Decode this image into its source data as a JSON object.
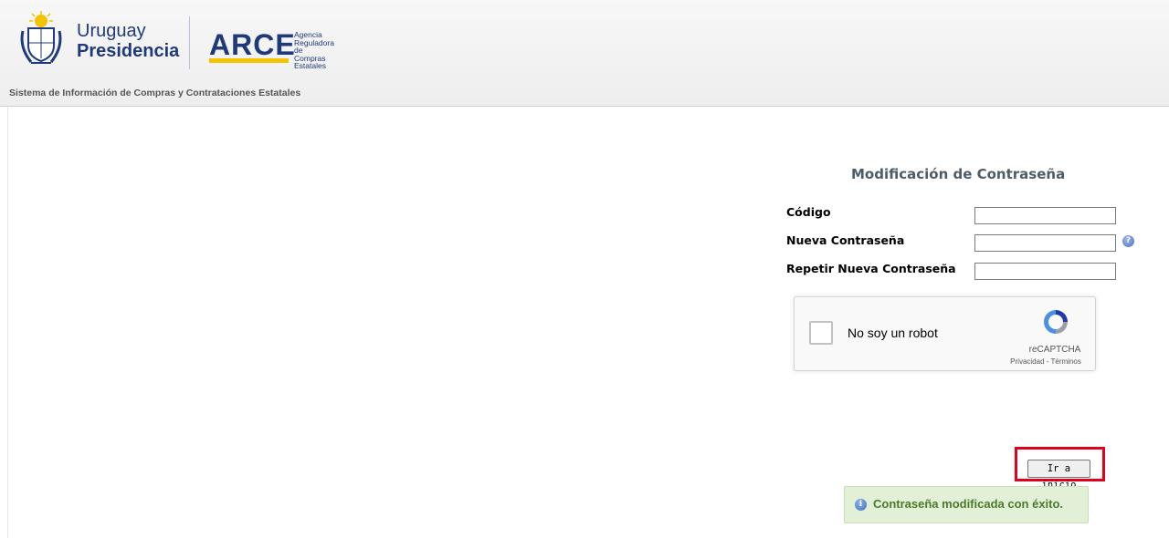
{
  "header": {
    "gob_line1": "Uruguay",
    "gob_line2": "Presidencia",
    "arce_name": "ARCE",
    "arce_sub1": "Agencia",
    "arce_sub2": "Reguladora de",
    "arce_sub3": "Compras Estatales",
    "system_title": "Sistema de Información de Compras y Contrataciones Estatales"
  },
  "form": {
    "title": "Modificación de Contraseña",
    "codigo_label": "Código",
    "codigo_value": "",
    "nueva_label": "Nueva Contraseña",
    "nueva_value": "",
    "repetir_label": "Repetir Nueva Contraseña",
    "repetir_value": "",
    "help_icon": "?"
  },
  "captcha": {
    "label": "No soy un robot",
    "brand": "reCAPTCHA",
    "links": "Privacidad - Términos"
  },
  "actions": {
    "ir_inicio": "Ir a inicio"
  },
  "message": {
    "icon": "i",
    "text": "Contraseña modificada con éxito."
  },
  "colors": {
    "brand_blue": "#1f3a7a",
    "brand_yellow": "#f3c300",
    "success_bg": "#e1f0d6",
    "success_text": "#4b7a2b",
    "highlight": "#e0001b"
  }
}
